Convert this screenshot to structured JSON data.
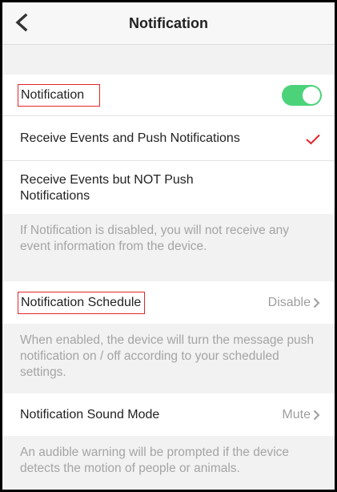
{
  "header": {
    "title": "Notification"
  },
  "notification": {
    "label": "Notification",
    "toggle_on": true
  },
  "options": [
    {
      "label": "Receive Events and Push Notifications",
      "selected": true
    },
    {
      "label_line1": "Receive Events but NOT Push",
      "label_line2": "Notifications",
      "selected": false
    }
  ],
  "notification_desc": "If Notification is disabled, you will not receive any event information from the device.",
  "schedule": {
    "label": "Notification Schedule",
    "value": "Disable"
  },
  "schedule_desc": "When enabled, the device will turn the message push notification on / off according to your scheduled settings.",
  "sound": {
    "label": "Notification Sound Mode",
    "value": "Mute"
  },
  "sound_desc": "An audible warning will be prompted if the device detects the motion of people or animals.",
  "colors": {
    "toggle": "#4cd37a",
    "check": "#e0262b",
    "highlight": "#e0262b"
  }
}
